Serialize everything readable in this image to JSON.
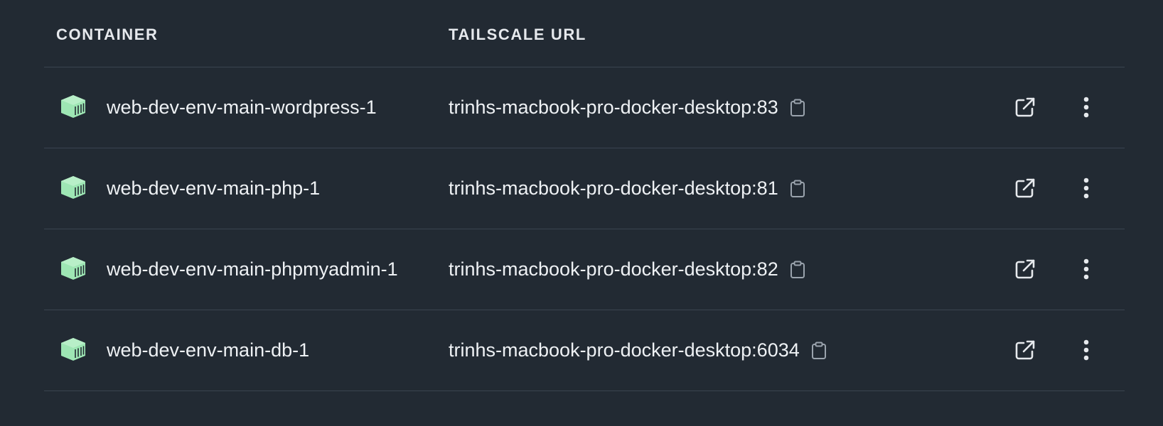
{
  "table": {
    "columns": {
      "container": "CONTAINER",
      "tailscale_url": "TAILSCALE URL"
    },
    "rows": [
      {
        "container": "web-dev-env-main-wordpress-1",
        "url": "trinhs-macbook-pro-docker-desktop:83"
      },
      {
        "container": "web-dev-env-main-php-1",
        "url": "trinhs-macbook-pro-docker-desktop:81"
      },
      {
        "container": "web-dev-env-main-phpmyadmin-1",
        "url": "trinhs-macbook-pro-docker-desktop:82"
      },
      {
        "container": "web-dev-env-main-db-1",
        "url": "trinhs-macbook-pro-docker-desktop:6034"
      }
    ]
  },
  "icons": {
    "row_icon": "container-icon",
    "copy": "clipboard-icon",
    "open": "external-link-icon",
    "more": "more-vertical-icon"
  },
  "colors": {
    "background": "#222a33",
    "divider": "#3a4450",
    "container_icon": "#9ee6b4",
    "text": "#eef1f4"
  }
}
